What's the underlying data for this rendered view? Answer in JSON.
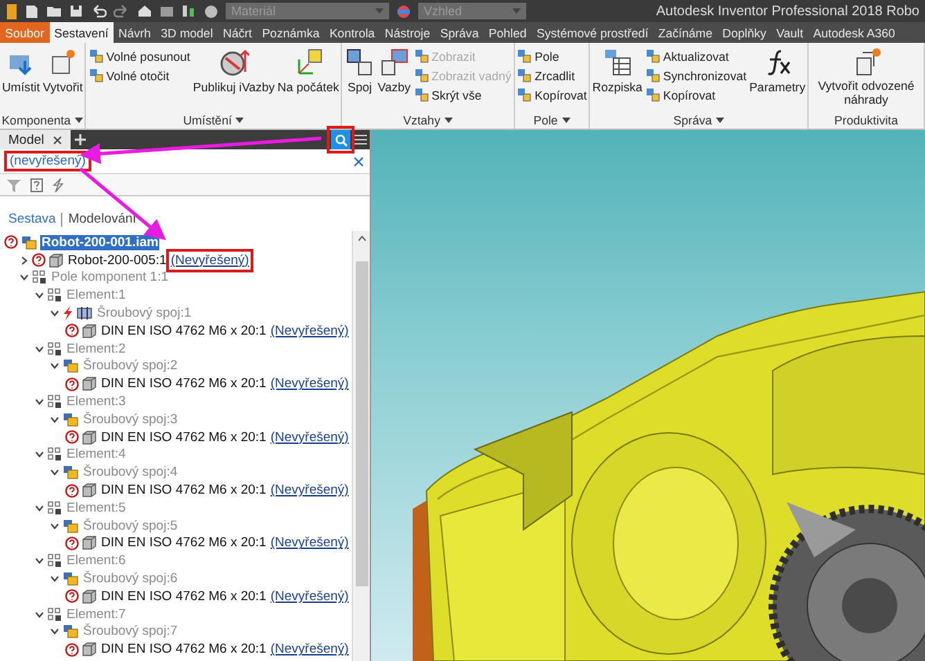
{
  "title_bar": {
    "material": "Materiál",
    "appearance": "Vzhled",
    "title": "Autodesk Inventor Professional 2018   Robo"
  },
  "ribbon_tabs": [
    {
      "label": "Soubor",
      "kind": "file",
      "selected": false
    },
    {
      "label": "Sestavení",
      "kind": "tab",
      "selected": true
    },
    {
      "label": "Návrh",
      "kind": "tab",
      "selected": false
    },
    {
      "label": "3D model",
      "kind": "tab",
      "selected": false
    },
    {
      "label": "Náčrt",
      "kind": "tab",
      "selected": false
    },
    {
      "label": "Poznámka",
      "kind": "tab",
      "selected": false
    },
    {
      "label": "Kontrola",
      "kind": "tab",
      "selected": false
    },
    {
      "label": "Nástroje",
      "kind": "tab",
      "selected": false
    },
    {
      "label": "Správa",
      "kind": "tab",
      "selected": false
    },
    {
      "label": "Pohled",
      "kind": "tab",
      "selected": false
    },
    {
      "label": "Systémové prostředí",
      "kind": "tab",
      "selected": false
    },
    {
      "label": "Začínáme",
      "kind": "tab",
      "selected": false
    },
    {
      "label": "Doplňky",
      "kind": "tab",
      "selected": false
    },
    {
      "label": "Vault",
      "kind": "tab",
      "selected": false
    },
    {
      "label": "Autodesk A360",
      "kind": "tab",
      "selected": false
    }
  ],
  "ribbon_groups": [
    {
      "label": "Komponenta",
      "menu": true,
      "columns": [
        {
          "kind": "large",
          "label": "Umístit"
        },
        {
          "kind": "large",
          "label": "Vytvořit"
        }
      ]
    },
    {
      "label": "Umístění",
      "menu": true,
      "columns": [
        {
          "kind": "stack",
          "items": [
            {
              "label": "Volné posunout",
              "disabled": false
            },
            {
              "label": "Volné otočit",
              "disabled": false
            }
          ]
        },
        {
          "kind": "large",
          "label": "Publikuj iVazby"
        },
        {
          "kind": "large",
          "label": "Na počátek"
        }
      ]
    },
    {
      "label": "Vztahy",
      "menu": true,
      "columns": [
        {
          "kind": "large",
          "label": "Spoj"
        },
        {
          "kind": "large",
          "label": "Vazby"
        },
        {
          "kind": "stack",
          "items": [
            {
              "label": "Zobrazit",
              "disabled": true
            },
            {
              "label": "Zobrazit vadný",
              "disabled": true
            },
            {
              "label": "Skrýt vše",
              "disabled": false
            }
          ]
        }
      ]
    },
    {
      "label": "Pole",
      "menu": true,
      "columns": [
        {
          "kind": "stack",
          "items": [
            {
              "label": "Pole",
              "disabled": false
            },
            {
              "label": "Zrcadlit",
              "disabled": false
            },
            {
              "label": "Kopírovat",
              "disabled": false
            }
          ]
        }
      ]
    },
    {
      "label": "Správa",
      "menu": true,
      "columns": [
        {
          "kind": "large",
          "label": "Rozpiska"
        },
        {
          "kind": "stack",
          "items": [
            {
              "label": "Aktualizovat",
              "disabled": false
            },
            {
              "label": "Synchronizovat",
              "disabled": false
            },
            {
              "label": "Kopírovat",
              "disabled": false
            }
          ]
        },
        {
          "kind": "large",
          "label": "Parametry"
        }
      ]
    },
    {
      "label": "Produktivita",
      "menu": false,
      "columns": [
        {
          "kind": "large",
          "label": "Vytvořit odvozené náhrady"
        }
      ]
    }
  ],
  "browser": {
    "tab": "Model",
    "search_value": "(nevyřešený)",
    "views": [
      {
        "label": "Sestava",
        "selected": true
      },
      {
        "label": "Modelování",
        "selected": false
      }
    ],
    "tree": [
      {
        "label": "Robot-200-001.iam",
        "kind": "assembly",
        "unresolved": true,
        "selected": true,
        "children": [
          {
            "label": "Robot-200-005:1",
            "kind": "part",
            "unresolved": true,
            "link": "(Nevyřešený)",
            "expanded": false,
            "selected": false
          },
          {
            "label": "Pole komponent 1:1",
            "kind": "pattern",
            "expanded": true,
            "dimmed": true,
            "selected": false,
            "children": [
              {
                "label": "Element:1",
                "kind": "pattern",
                "expanded": true,
                "dimmed": true,
                "selected": false,
                "children": [
                  {
                    "label": "Šroubový spoj:1",
                    "kind": "bolted",
                    "warning": true,
                    "expanded": true,
                    "dimmed": true,
                    "selected": false,
                    "children": [
                      {
                        "label": "DIN EN ISO 4762 M6 x 20:1",
                        "kind": "part",
                        "unresolved": true,
                        "link": "(Nevyřešený)",
                        "selected": false
                      }
                    ]
                  }
                ]
              },
              {
                "label": "Element:2",
                "kind": "pattern",
                "expanded": true,
                "dimmed": true,
                "selected": false,
                "children": [
                  {
                    "label": "Šroubový spoj:2",
                    "kind": "assembly",
                    "expanded": true,
                    "dimmed": true,
                    "selected": false,
                    "children": [
                      {
                        "label": "DIN EN ISO 4762 M6 x 20:1",
                        "kind": "part",
                        "unresolved": true,
                        "link": "(Nevyřešený)",
                        "selected": false
                      }
                    ]
                  }
                ]
              },
              {
                "label": "Element:3",
                "kind": "pattern",
                "expanded": true,
                "dimmed": true,
                "selected": false,
                "children": [
                  {
                    "label": "Šroubový spoj:3",
                    "kind": "assembly",
                    "expanded": true,
                    "dimmed": true,
                    "selected": false,
                    "children": [
                      {
                        "label": "DIN EN ISO 4762 M6 x 20:1",
                        "kind": "part",
                        "unresolved": true,
                        "link": "(Nevyřešený)",
                        "selected": false
                      }
                    ]
                  }
                ]
              },
              {
                "label": "Element:4",
                "kind": "pattern",
                "expanded": true,
                "dimmed": true,
                "selected": false,
                "children": [
                  {
                    "label": "Šroubový spoj:4",
                    "kind": "assembly",
                    "expanded": true,
                    "dimmed": true,
                    "selected": false,
                    "children": [
                      {
                        "label": "DIN EN ISO 4762 M6 x 20:1",
                        "kind": "part",
                        "unresolved": true,
                        "link": "(Nevyřešený)",
                        "selected": false
                      }
                    ]
                  }
                ]
              },
              {
                "label": "Element:5",
                "kind": "pattern",
                "expanded": true,
                "dimmed": true,
                "selected": false,
                "children": [
                  {
                    "label": "Šroubový spoj:5",
                    "kind": "assembly",
                    "expanded": true,
                    "dimmed": true,
                    "selected": false,
                    "children": [
                      {
                        "label": "DIN EN ISO 4762 M6 x 20:1",
                        "kind": "part",
                        "unresolved": true,
                        "link": "(Nevyřešený)",
                        "selected": false
                      }
                    ]
                  }
                ]
              },
              {
                "label": "Element:6",
                "kind": "pattern",
                "expanded": true,
                "dimmed": true,
                "selected": false,
                "children": [
                  {
                    "label": "Šroubový spoj:6",
                    "kind": "assembly",
                    "expanded": true,
                    "dimmed": true,
                    "selected": false,
                    "children": [
                      {
                        "label": "DIN EN ISO 4762 M6 x 20:1",
                        "kind": "part",
                        "unresolved": true,
                        "link": "(Nevyřešený)",
                        "selected": false
                      }
                    ]
                  }
                ]
              },
              {
                "label": "Element:7",
                "kind": "pattern",
                "expanded": true,
                "dimmed": true,
                "selected": false,
                "children": [
                  {
                    "label": "Šroubový spoj:7",
                    "kind": "assembly",
                    "expanded": true,
                    "dimmed": true,
                    "selected": false,
                    "children": [
                      {
                        "label": "DIN EN ISO 4762 M6 x 20:1",
                        "kind": "part",
                        "unresolved": true,
                        "link": "(Nevyřešený)",
                        "selected": false
                      }
                    ]
                  }
                ]
              }
            ]
          }
        ]
      }
    ]
  }
}
